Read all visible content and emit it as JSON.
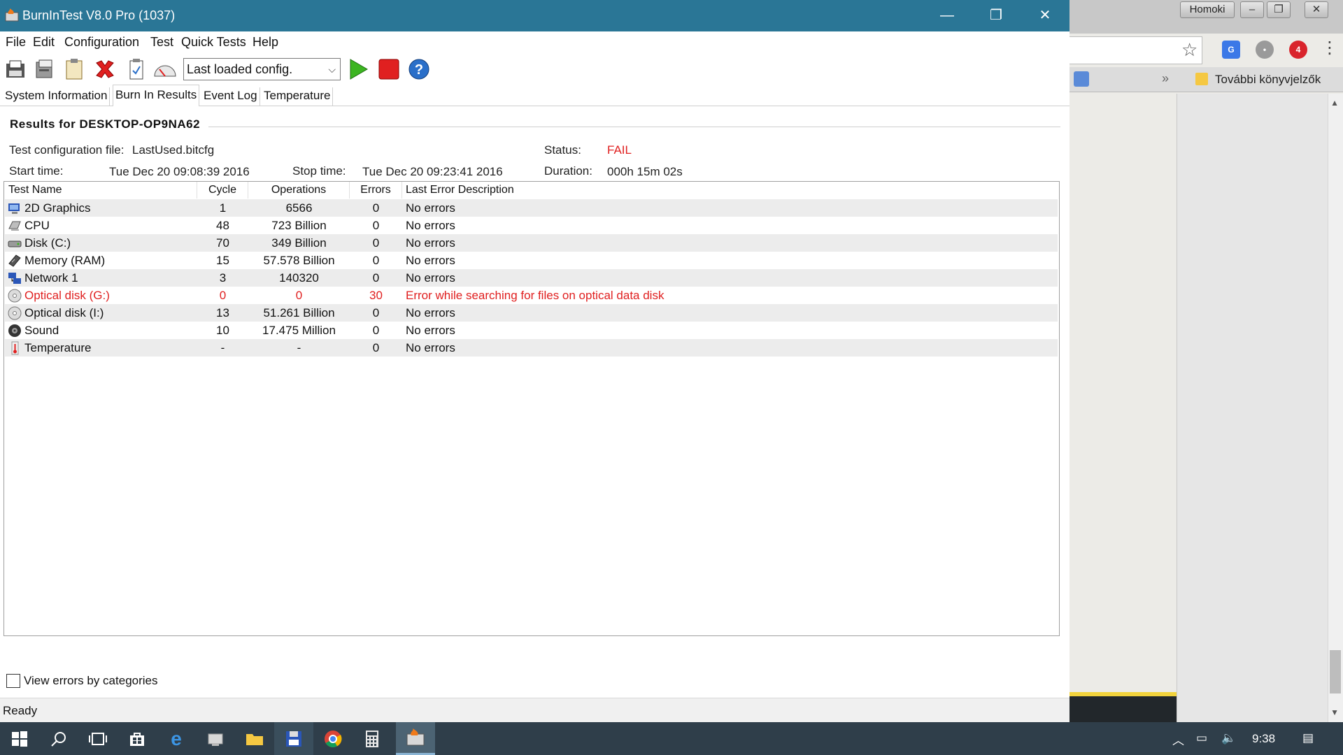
{
  "browser": {
    "profile_label": "Homoki",
    "extension_badge": "4",
    "bookmark_more": "»",
    "bookmark_folder": "További könyvjelzők"
  },
  "window": {
    "title": "BurnInTest V8.0 Pro (1037)",
    "minimize_icon": "minimize-icon",
    "restore_icon": "restore-icon",
    "close_icon": "close-icon"
  },
  "menu": {
    "items": [
      "File",
      "Edit",
      "Configuration",
      "Test",
      "Quick Tests",
      "Help"
    ]
  },
  "toolbar": {
    "config_combo_value": "Last loaded config.",
    "icons": [
      "save-icon",
      "print-icon",
      "clipboard-icon",
      "clear-results-icon",
      "clipboard-check-icon",
      "speedometer-icon",
      "start-icon",
      "stop-icon",
      "help-icon"
    ]
  },
  "tabs": [
    "System Information",
    "Burn In Results",
    "Event Log",
    "Temperature"
  ],
  "active_tab": "Burn In Results",
  "results": {
    "heading": "Results for DESKTOP-OP9NA62",
    "config_label": "Test configuration file:",
    "config_value": "LastUsed.bitcfg",
    "status_label": "Status:",
    "status_value": "FAIL",
    "start_label": "Start time:",
    "start_value": "Tue Dec 20 09:08:39 2016",
    "stop_label": "Stop time:",
    "stop_value": "Tue Dec 20 09:23:41 2016",
    "duration_label": "Duration:",
    "duration_value": "000h 15m 02s"
  },
  "table": {
    "columns": [
      "Test Name",
      "Cycle",
      "Operations",
      "Errors",
      "Last Error Description"
    ],
    "rows": [
      {
        "icon": "2d-graphics-icon",
        "name": "2D Graphics",
        "cycle": "1",
        "operations": "6566",
        "errors": "0",
        "desc": "No errors",
        "error": false
      },
      {
        "icon": "cpu-icon",
        "name": "CPU",
        "cycle": "48",
        "operations": "723 Billion",
        "errors": "0",
        "desc": "No errors",
        "error": false
      },
      {
        "icon": "disk-icon",
        "name": "Disk (C:)",
        "cycle": "70",
        "operations": "349 Billion",
        "errors": "0",
        "desc": "No errors",
        "error": false
      },
      {
        "icon": "memory-icon",
        "name": "Memory (RAM)",
        "cycle": "15",
        "operations": "57.578 Billion",
        "errors": "0",
        "desc": "No errors",
        "error": false
      },
      {
        "icon": "network-icon",
        "name": "Network 1",
        "cycle": "3",
        "operations": "140320",
        "errors": "0",
        "desc": "No errors",
        "error": false
      },
      {
        "icon": "optical-disk-icon",
        "name": "Optical disk (G:)",
        "cycle": "0",
        "operations": "0",
        "errors": "30",
        "desc": "Error while searching for files on optical data disk",
        "error": true
      },
      {
        "icon": "optical-disk-icon",
        "name": "Optical disk (I:)",
        "cycle": "13",
        "operations": "51.261 Billion",
        "errors": "0",
        "desc": "No errors",
        "error": false
      },
      {
        "icon": "sound-icon",
        "name": "Sound",
        "cycle": "10",
        "operations": "17.475 Million",
        "errors": "0",
        "desc": "No errors",
        "error": false
      },
      {
        "icon": "thermometer-icon",
        "name": "Temperature",
        "cycle": "-",
        "operations": "-",
        "errors": "0",
        "desc": "No errors",
        "error": false
      }
    ]
  },
  "checkbox": {
    "label": "View errors by categories",
    "checked": false
  },
  "status_bar": "Ready",
  "taskbar": {
    "clock": "9:38",
    "items": [
      "start-icon",
      "search-icon",
      "task-view-icon",
      "store-icon",
      "edge-icon",
      "app-icon",
      "file-explorer-icon",
      "floppy-app-icon",
      "chrome-icon",
      "calculator-icon",
      "burnintest-icon"
    ]
  },
  "colors": {
    "titlebar": "#2a7696",
    "fail_red": "#e02020",
    "taskbar": "#2f3e4a"
  }
}
